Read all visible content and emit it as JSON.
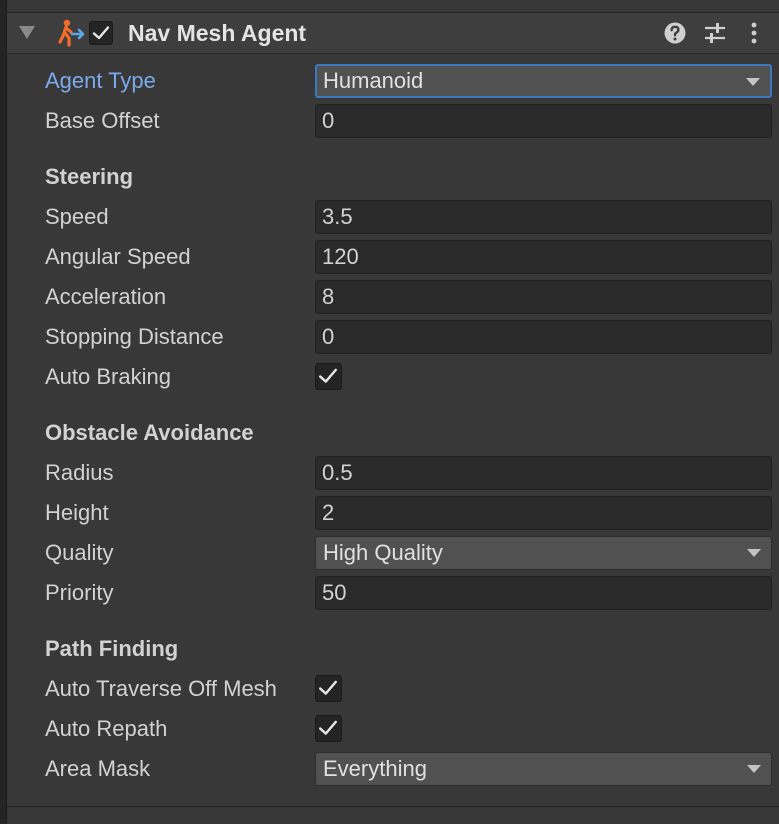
{
  "component": {
    "title": "Nav Mesh Agent",
    "enabled": true,
    "icons": [
      "foldout-arrow-icon",
      "nav-agent-icon",
      "help-icon",
      "preset-sliders-icon",
      "kebab-menu-icon"
    ]
  },
  "fields": {
    "agent_type": {
      "label": "Agent Type",
      "value": "Humanoid"
    },
    "base_offset": {
      "label": "Base Offset",
      "value": "0"
    }
  },
  "steering": {
    "title": "Steering",
    "speed": {
      "label": "Speed",
      "value": "3.5"
    },
    "angular_speed": {
      "label": "Angular Speed",
      "value": "120"
    },
    "acceleration": {
      "label": "Acceleration",
      "value": "8"
    },
    "stopping_distance": {
      "label": "Stopping Distance",
      "value": "0"
    },
    "auto_braking": {
      "label": "Auto Braking",
      "checked": true
    }
  },
  "obstacle_avoidance": {
    "title": "Obstacle Avoidance",
    "radius": {
      "label": "Radius",
      "value": "0.5"
    },
    "height": {
      "label": "Height",
      "value": "2"
    },
    "quality": {
      "label": "Quality",
      "value": "High Quality"
    },
    "priority": {
      "label": "Priority",
      "value": "50"
    }
  },
  "path_finding": {
    "title": "Path Finding",
    "auto_traverse": {
      "label": "Auto Traverse Off Mesh",
      "checked": true
    },
    "auto_repath": {
      "label": "Auto Repath",
      "checked": true
    },
    "area_mask": {
      "label": "Area Mask",
      "value": "Everything"
    }
  },
  "colors": {
    "background": "#383838",
    "header": "#3e3e3e",
    "field": "#2a2a2a",
    "dropdown": "#515151",
    "focus_border": "#3c78bf",
    "highlight_label": "#7ba9ea",
    "agent_icon_orange": "#f46b2a",
    "agent_icon_blue": "#5aa7e8"
  }
}
